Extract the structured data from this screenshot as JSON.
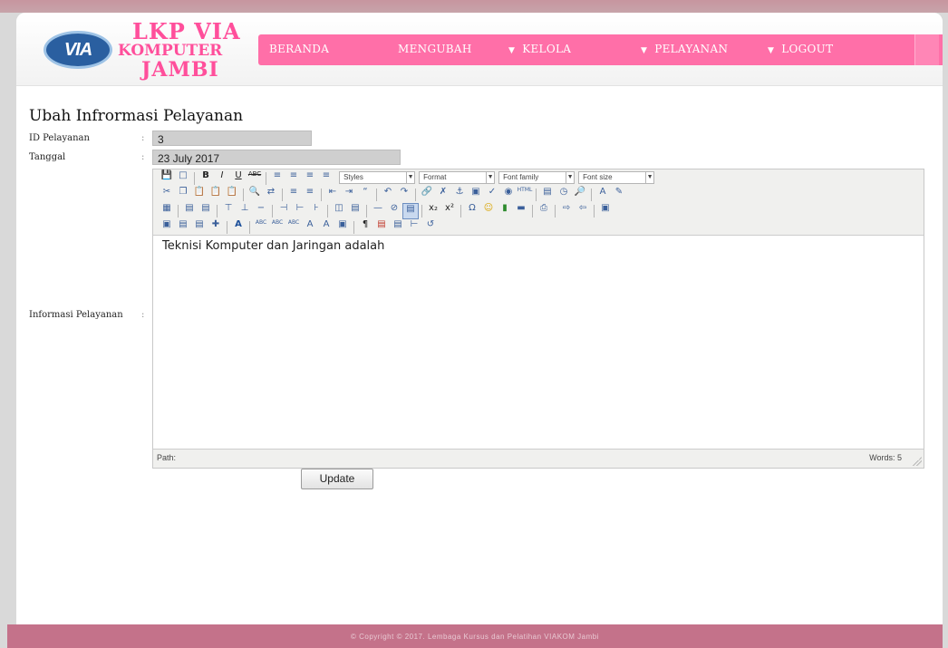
{
  "header": {
    "logo": {
      "mark_text": "VIA",
      "line1": "LKP VIA",
      "line2": "KOMPUTER",
      "line3": "JAMBI"
    },
    "nav": [
      {
        "label": "BERANDA",
        "dropdown": false
      },
      {
        "label": "MENGUBAH",
        "dropdown": false
      },
      {
        "label": "KELOLA",
        "dropdown": true
      },
      {
        "label": "PELAYANAN",
        "dropdown": true
      },
      {
        "label": "LOGOUT",
        "dropdown": true
      }
    ]
  },
  "form": {
    "title": "Ubah Infrormasi Pelayanan",
    "separator": ":",
    "id_label": "ID Pelayanan",
    "id_value": "3",
    "date_label": "Tanggal",
    "date_value": "23 July 2017",
    "info_label": "Informasi Pelayanan",
    "submit_label": "Update"
  },
  "editor": {
    "selects": [
      "Styles",
      "Format",
      "Font family",
      "Font size"
    ],
    "content": "Teknisi Komputer dan Jaringan adalah",
    "path_label": "Path:",
    "word_count": "Words: 5"
  },
  "footer": {
    "copyright": "© Copyright © 2017. Lembaga Kursus dan Pelatihan VIAKOM Jambi"
  },
  "colors": {
    "nav_bg": "#ff6fa8",
    "logo_pink": "#ff4f9b",
    "logo_blue": "#2a5fa0",
    "footer_bg": "#c4728a"
  }
}
